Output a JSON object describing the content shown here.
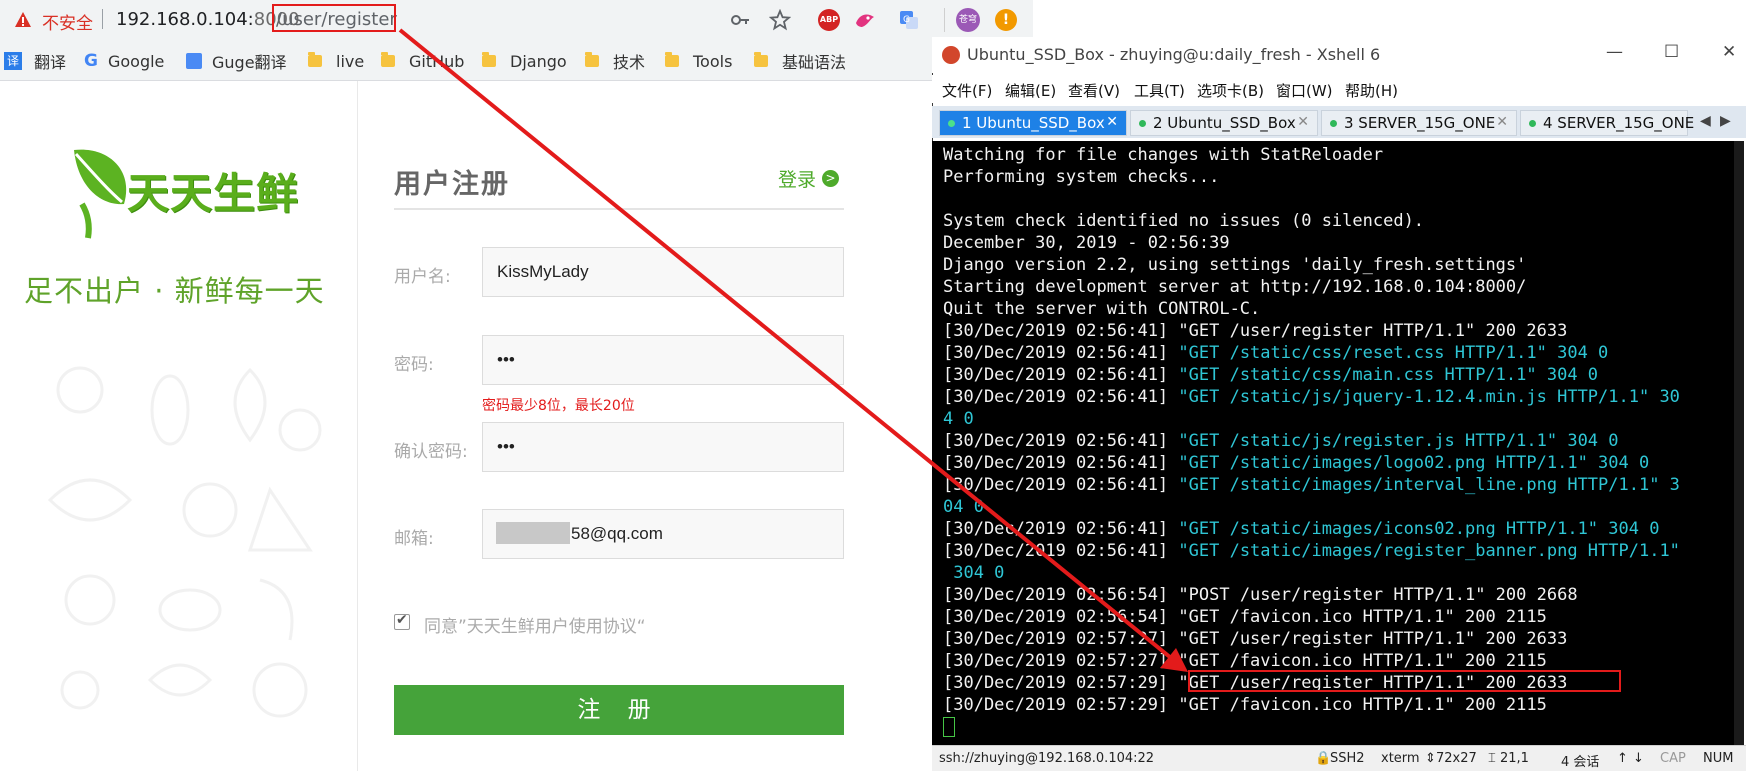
{
  "browser": {
    "insecure_label": "不安全",
    "url_host": "192.168.0.104:",
    "url_port": "8000",
    "url_path": "/user/register",
    "bookmarks": [
      "翻译",
      "Google",
      "Guge翻译",
      "live",
      "GitHub",
      "Django",
      "技术",
      "Tools",
      "基础语法"
    ],
    "extension_badges": [
      "ABP",
      "苍穹"
    ]
  },
  "page": {
    "logo_text": "天天生鲜",
    "slogan": "足不出户 · 新鲜每一天",
    "form_title": "用户注册",
    "login_link": "登录",
    "labels": {
      "username": "用户名:",
      "password": "密码:",
      "confirm": "确认密码:",
      "email": "邮箱:"
    },
    "values": {
      "username": "KissMyLady",
      "password": "•••",
      "confirm": "•••",
      "email": "58@qq.com"
    },
    "password_error": "密码最少8位，最长20位",
    "agree_text": "同意”天天生鲜用户使用协议“",
    "submit_label": "注 册"
  },
  "xshell": {
    "title": "Ubuntu_SSD_Box - zhuying@u:daily_fresh - Xshell 6",
    "menu": [
      "文件(F)",
      "编辑(E)",
      "查看(V)",
      "工具(T)",
      "选项卡(B)",
      "窗口(W)",
      "帮助(H)"
    ],
    "tabs": [
      "1 Ubuntu_SSD_Box",
      "2 Ubuntu_SSD_Box",
      "3 SERVER_15G_ONE",
      "4 SERVER_15G_ONE"
    ],
    "lines": [
      {
        "ts": "",
        "req": "",
        "tail": "Watching for file changes with StatReloader"
      },
      {
        "ts": "",
        "req": "",
        "tail": "Performing system checks..."
      },
      {
        "ts": "",
        "req": "",
        "tail": ""
      },
      {
        "ts": "",
        "req": "",
        "tail": "System check identified no issues (0 silenced)."
      },
      {
        "ts": "",
        "req": "",
        "tail": "December 30, 2019 - 02:56:39"
      },
      {
        "ts": "",
        "req": "",
        "tail": "Django version 2.2, using settings 'daily_fresh.settings'"
      },
      {
        "ts": "",
        "req": "",
        "tail": "Starting development server at http://192.168.0.104:8000/"
      },
      {
        "ts": "",
        "req": "",
        "tail": "Quit the server with CONTROL-C."
      },
      {
        "ts": "[30/Dec/2019 02:56:41] ",
        "req": "",
        "tail": "\"GET /user/register HTTP/1.1\" 200 2633"
      },
      {
        "ts": "[30/Dec/2019 02:56:41] ",
        "req": "\"GET /static/css/reset.css HTTP/1.1\" 304 0",
        "tail": ""
      },
      {
        "ts": "[30/Dec/2019 02:56:41] ",
        "req": "\"GET /static/css/main.css HTTP/1.1\" 304 0",
        "tail": ""
      },
      {
        "ts": "[30/Dec/2019 02:56:41] ",
        "req": "\"GET /static/js/jquery-1.12.4.min.js HTTP/1.1\" 30",
        "tail": ""
      },
      {
        "ts": "",
        "req": "4 0",
        "tail": ""
      },
      {
        "ts": "[30/Dec/2019 02:56:41] ",
        "req": "\"GET /static/js/register.js HTTP/1.1\" 304 0",
        "tail": ""
      },
      {
        "ts": "[30/Dec/2019 02:56:41] ",
        "req": "\"GET /static/images/logo02.png HTTP/1.1\" 304 0",
        "tail": ""
      },
      {
        "ts": "[30/Dec/2019 02:56:41] ",
        "req": "\"GET /static/images/interval_line.png HTTP/1.1\" 3",
        "tail": ""
      },
      {
        "ts": "",
        "req": "04 0",
        "tail": ""
      },
      {
        "ts": "[30/Dec/2019 02:56:41] ",
        "req": "\"GET /static/images/icons02.png HTTP/1.1\" 304 0",
        "tail": ""
      },
      {
        "ts": "[30/Dec/2019 02:56:41] ",
        "req": "\"GET /static/images/register_banner.png HTTP/1.1\"",
        "tail": ""
      },
      {
        "ts": "",
        "req": " 304 0",
        "tail": ""
      },
      {
        "ts": "[30/Dec/2019 02:56:54] ",
        "req": "",
        "tail": "\"POST /user/register HTTP/1.1\" 200 2668"
      },
      {
        "ts": "[30/Dec/2019 02:56:54] ",
        "req": "",
        "tail": "\"GET /favicon.ico HTTP/1.1\" 200 2115"
      },
      {
        "ts": "[30/Dec/2019 02:57:27] ",
        "req": "",
        "tail": "\"GET /user/register HTTP/1.1\" 200 2633"
      },
      {
        "ts": "[30/Dec/2019 02:57:27] ",
        "req": "",
        "tail": "\"GET /favicon.ico HTTP/1.1\" 200 2115"
      },
      {
        "ts": "[30/Dec/2019 02:57:29] ",
        "req": "",
        "tail": "\"GET /user/register HTTP/1.1\" 200 2633"
      },
      {
        "ts": "[30/Dec/2019 02:57:29] ",
        "req": "",
        "tail": "\"GET /favicon.ico HTTP/1.1\" 200 2115"
      }
    ],
    "status": {
      "connection": "ssh://zhuying@192.168.0.104:22",
      "protocol": "SSH2",
      "term": "xterm",
      "size": "72x27",
      "cursor": "21,1",
      "sessions": "4 会话",
      "caps": "CAP",
      "num": "NUM"
    }
  },
  "colors": {
    "highlight": "#e31b1b",
    "brand_green": "#45a33a",
    "terminal_cyan": "#2fc6d5"
  }
}
